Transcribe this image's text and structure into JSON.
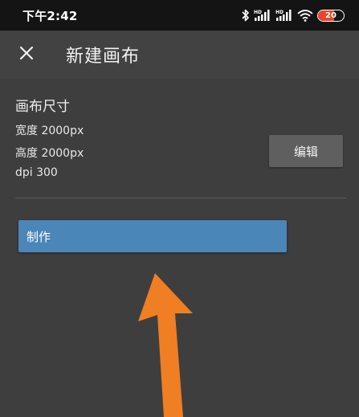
{
  "status_bar": {
    "time": "下午2:42",
    "battery_level": "20",
    "battery_color": "#e8452c",
    "icons": [
      "bluetooth-icon",
      "hd-signal-icon",
      "hd-signal-icon",
      "wifi-icon",
      "battery-icon"
    ]
  },
  "app_bar": {
    "close_icon": "close-icon",
    "title": "新建画布"
  },
  "canvas_size": {
    "heading": "画布尺寸",
    "width": "宽度 2000px",
    "height": "高度 2000px",
    "dpi": "dpi 300",
    "edit_label": "编辑"
  },
  "actions": {
    "make_label": "制作",
    "make_color": "#4a86b8"
  },
  "annotation": {
    "arrow_icon": "orange-arrow-icon",
    "arrow_color": "#f07e23"
  }
}
